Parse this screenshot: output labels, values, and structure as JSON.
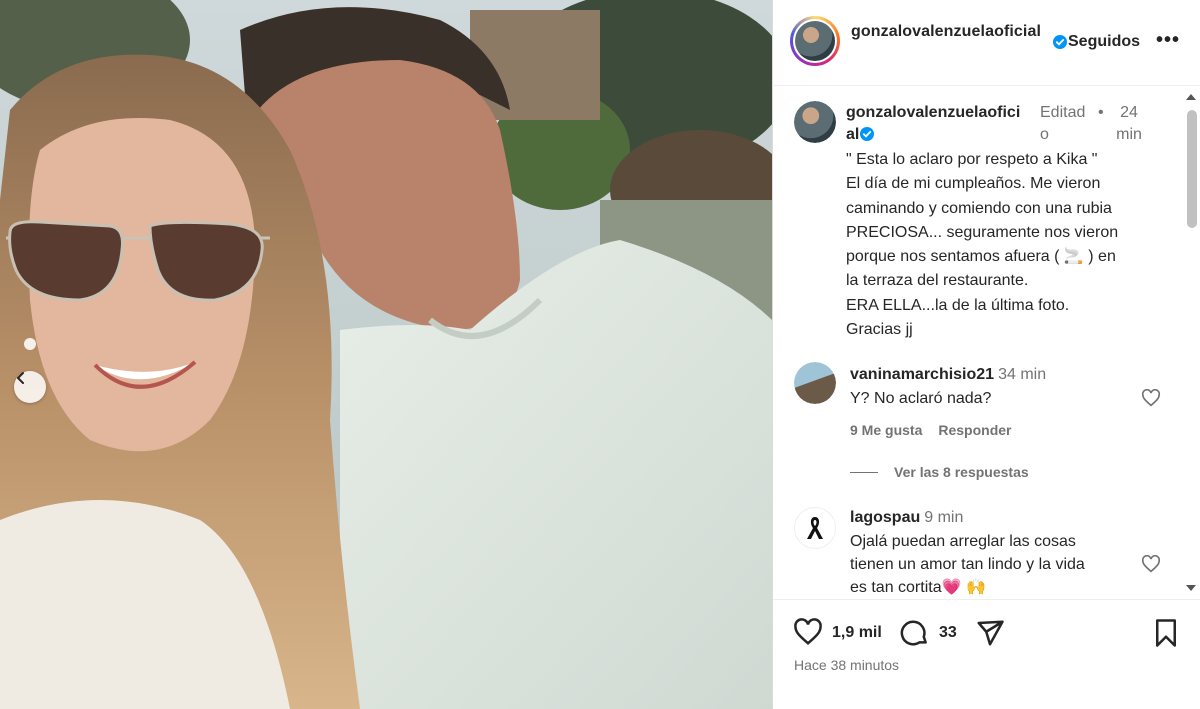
{
  "post": {
    "username": "gonzalovalenzuelaoficial",
    "follow_status": "Seguidos",
    "more_label": "•••",
    "verified_icon": "verified-badge-icon"
  },
  "caption": {
    "username": "gonzalovalenzuelaoficial",
    "edited": "Editado",
    "time": "24 min",
    "lines": [
      "\" Esta lo aclaro por respeto a Kika \"",
      "El día de mi cumpleaños. Me vieron",
      "caminando y comiendo con una rubia",
      "PRECIOSA... seguramente nos vieron",
      "porque nos sentamos afuera ( 🚬 ) en",
      "la terraza del restaurante.",
      "ERA ELLA...la de la última foto.",
      "Gracias jj"
    ]
  },
  "comments": [
    {
      "username": "vaninamarchisio21",
      "time": "34 min",
      "lines": [
        "Y? No aclaró nada?"
      ],
      "likes": "9 Me gusta",
      "reply": "Responder",
      "view_replies": "Ver las 8 respuestas"
    },
    {
      "username": "lagospau",
      "time": "9 min",
      "lines": [
        "Ojalá puedan arreglar las cosas",
        "tienen un amor tan lindo y la vida",
        "es tan cortita💗 🙌"
      ]
    }
  ],
  "actions": {
    "likes": "1,9 mil",
    "comments": "33",
    "posted": "Hace 38 minutos"
  },
  "colors": {
    "accent": "#0095f6",
    "muted": "#737373",
    "text": "#262626"
  }
}
